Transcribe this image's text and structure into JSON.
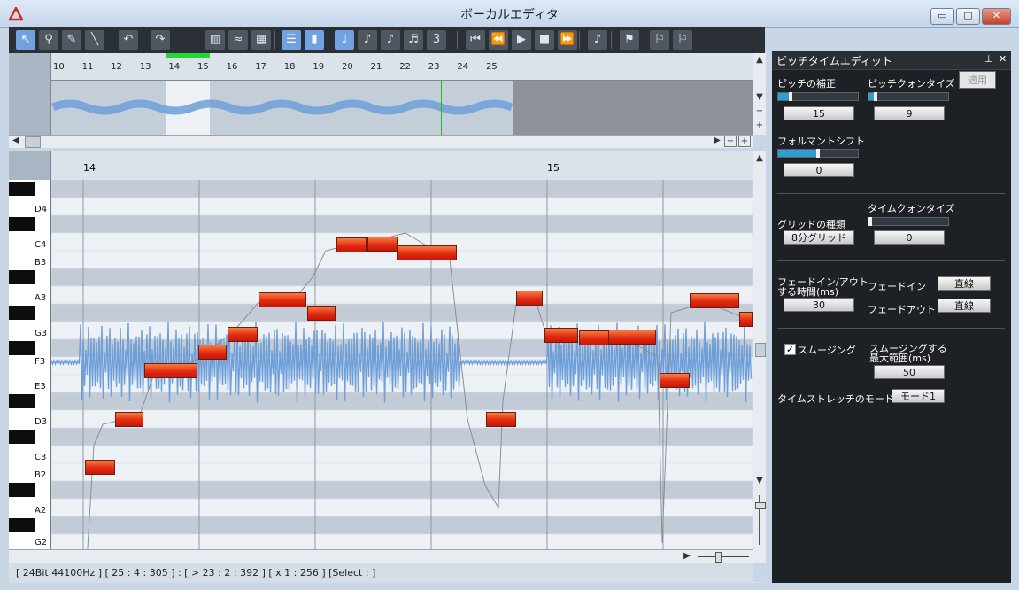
{
  "window": {
    "title": "ボーカルエディタ",
    "minimize": "▭",
    "maximize": "□",
    "close": "✕"
  },
  "toolbar": {
    "buttons": [
      {
        "name": "select-tool-icon",
        "glyph": "↖"
      },
      {
        "name": "zoom-tool-icon",
        "glyph": "⚲"
      },
      {
        "name": "pencil-tool-icon",
        "glyph": "✎"
      },
      {
        "name": "line-tool-icon",
        "glyph": "╲"
      },
      {
        "name": "undo-icon",
        "glyph": "↶"
      },
      {
        "name": "redo-icon",
        "glyph": "↷"
      },
      {
        "name": "pitch-view-icon",
        "glyph": "▥"
      },
      {
        "name": "waveform-view-icon",
        "glyph": "≈"
      },
      {
        "name": "table-view-icon",
        "glyph": "▦"
      },
      {
        "name": "align-icon",
        "glyph": "☰"
      },
      {
        "name": "meter-icon",
        "glyph": "▮"
      },
      {
        "name": "note-whole-icon",
        "glyph": "♩"
      },
      {
        "name": "note-eighth-icon",
        "glyph": "♪"
      },
      {
        "name": "note-sixteenth-icon",
        "glyph": "♪"
      },
      {
        "name": "note-32nd-icon",
        "glyph": "♬"
      },
      {
        "name": "triplet-icon",
        "glyph": "3"
      },
      {
        "name": "goto-start-icon",
        "glyph": "⏮"
      },
      {
        "name": "rewind-icon",
        "glyph": "⏪"
      },
      {
        "name": "play-icon",
        "glyph": "▶"
      },
      {
        "name": "stop-icon",
        "glyph": "■"
      },
      {
        "name": "fast-forward-icon",
        "glyph": "⏩"
      },
      {
        "name": "metronome-icon",
        "glyph": "♪"
      },
      {
        "name": "flag-icon",
        "glyph": "⚑"
      },
      {
        "name": "marker-prev-icon",
        "glyph": "⚐"
      },
      {
        "name": "marker-next-icon",
        "glyph": "⚐"
      }
    ]
  },
  "overview": {
    "ticks": [
      "10",
      "11",
      "12",
      "13",
      "14",
      "15",
      "16",
      "17",
      "18",
      "19",
      "20",
      "21",
      "22",
      "23",
      "24",
      "25"
    ]
  },
  "editor": {
    "bar_labels": [
      "14",
      "15"
    ],
    "keys": [
      "D4",
      "C4",
      "B3",
      "A3",
      "G3",
      "F3",
      "E3",
      "D3",
      "C3",
      "B2",
      "A2",
      "G2"
    ]
  },
  "status": {
    "text": "[ 24Bit   44100Hz ]   [ 25 : 4 : 305 ] : [ > 23 : 2 : 392 ]  [ x 1 : 256 ]  [Select :  ]"
  },
  "panel": {
    "title": "ピッチタイムエディット",
    "pin": "⊥",
    "close": "✕",
    "apply": "適用",
    "pitch_correct_label": "ピッチの補正",
    "pitch_correct_value": "15",
    "pitch_correct_level": 0.15,
    "pitch_quantize_label": "ピッチクォンタイズ",
    "pitch_quantize_value": "9",
    "pitch_quantize_level": 0.09,
    "formant_label": "フォルマントシフト",
    "formant_value": "0",
    "formant_level": 0.5,
    "time_quantize_label": "タイムクォンタイズ",
    "time_quantize_value": "0",
    "grid_type_label": "グリッドの種類",
    "grid_type_value": "8分グリッド",
    "fade_label_1": "フェードイン/アウト",
    "fade_label_2": "する時間(ms)",
    "fade_value": "30",
    "fade_in_label": "フェードイン",
    "fade_in_value": "直線",
    "fade_out_label": "フェードアウト",
    "fade_out_value": "直線",
    "smoothing_label": "スムージング",
    "smoothing_range_label_1": "スムージングする",
    "smoothing_range_label_2": "最大範囲(ms)",
    "smoothing_range_value": "50",
    "stretch_mode_label": "タイムストレッチのモード",
    "stretch_mode_value": "モード1"
  },
  "colors": {
    "accent": "#2f9fd0",
    "note": "#e22b12",
    "wave": "#6f9fd8"
  }
}
